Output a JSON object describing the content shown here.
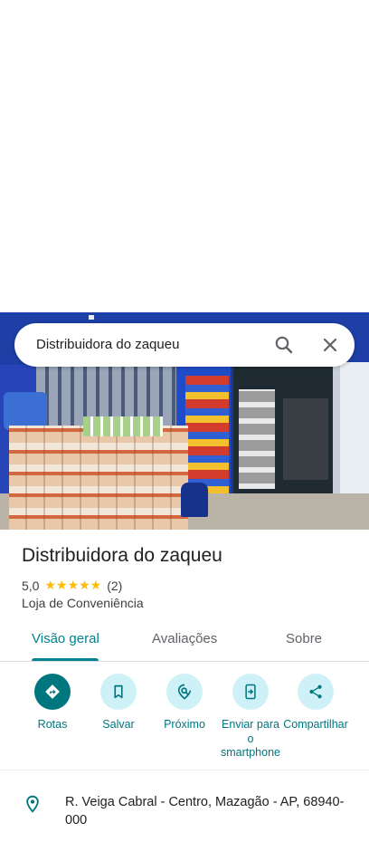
{
  "search": {
    "query": "Distribuidora do zaqueu"
  },
  "place": {
    "name": "Distribuidora do zaqueu",
    "rating": "5,0",
    "stars": "★★★★★",
    "review_count": "(2)",
    "category": "Loja de Conveniência",
    "address": "R. Veiga Cabral - Centro, Mazagão - AP, 68940-000"
  },
  "tabs": [
    {
      "label": "Visão geral",
      "active": true
    },
    {
      "label": "Avaliações",
      "active": false
    },
    {
      "label": "Sobre",
      "active": false
    }
  ],
  "actions": [
    {
      "label": "Rotas",
      "icon": "directions-icon"
    },
    {
      "label": "Salvar",
      "icon": "bookmark-icon"
    },
    {
      "label": "Próximo",
      "icon": "nearby-icon"
    },
    {
      "label": "Enviar para o smartphone",
      "icon": "send-to-phone-icon"
    },
    {
      "label": "Compartilhar",
      "icon": "share-icon"
    }
  ],
  "colors": {
    "accent": "#00767f",
    "accent_light": "#cdf1f6",
    "star": "#fbbc04"
  }
}
